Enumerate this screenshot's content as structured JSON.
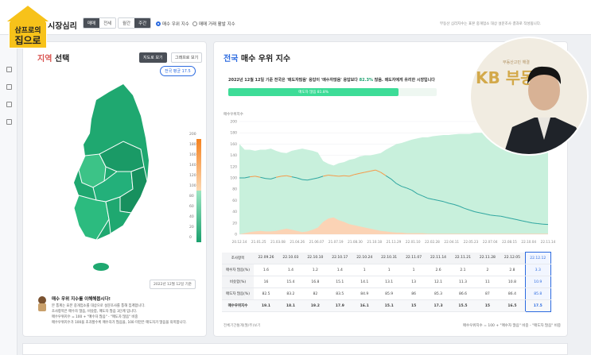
{
  "logo": {
    "line1": "삼프로의",
    "line2": "집으로"
  },
  "header": {
    "title": "시장심리",
    "seg1": [
      "매매",
      "전세"
    ],
    "seg2": [
      "월간",
      "주간"
    ],
    "radio1": "매수 우위 지수",
    "radio2": "매매 거래 활발 지수",
    "note": "부동산 심리지수는 표본 중개업소 대상 설문조사 결과로 작성됩니다."
  },
  "left": {
    "title_hl": "지역",
    "title_rest": " 선택",
    "btn_map": "지도로 보기",
    "btn_graph": "그래프로 보기",
    "pill": "전국 평균 17.5",
    "legend": [
      "200",
      "180",
      "160",
      "140",
      "120",
      "100",
      "80",
      "60",
      "40",
      "20",
      "0"
    ],
    "date": "2022년 12월 12일 기준",
    "info_title": "매수 우위 지수를 이해해봅시다!",
    "info_lines": [
      "본 통계는 표본 중개업소를 대상으로 설문조사를 통해 집계합니다.",
      "조사항목은 매수자 많음, 비슷함, 매도자 많음 3단계 입니다.",
      "매수우위지수 = 100 + \"매수자 많음\" - \"매도자 많음\" 비중",
      "매수우위지수가 100을 초과할수록 매수자가 많음을, 100 미만은 매도자가 많음을 의미합니다."
    ],
    "colors": {
      "map_green": "#1fa870",
      "map_light": "#3cc387",
      "accent": "#f5821f"
    }
  },
  "right": {
    "title_hl": "전국",
    "title_rest": " 매수 우위 지수",
    "summary_pre": "2022년 12월 12일 기준 전국은 '매도자많음' 응답이 '매수자많음' 응답보다 ",
    "summary_pct": "82.3%",
    "summary_post": " 많음. 매도자에게 유리한 시장입니다",
    "bar_label": "매도자 많음 81.8%",
    "bar_fraction": 0.818,
    "series_label": "매수우위지수",
    "footnote_left": "전체기간통계(월/주)보기",
    "footnote_right": "매수우위지수 = 100 + \"매수자 많음\" 비중 - \"매도자 많음\" 비중"
  },
  "chart_data": {
    "type": "area",
    "ylim": [
      0,
      200
    ],
    "yticks": [
      0,
      20,
      40,
      60,
      80,
      100,
      120,
      140,
      160,
      180,
      200
    ],
    "x_labels": [
      "20.12.14",
      "21.01.25",
      "21.03.08",
      "21.04.26",
      "21.06.07",
      "21.07.19",
      "21.08.30",
      "21.10.18",
      "21.11.29",
      "22.01.10",
      "22.02.28",
      "22.04.11",
      "22.05.23",
      "22.07.04",
      "22.08.15",
      "22.10.04",
      "22.11.14"
    ],
    "series": [
      {
        "values": [
          100,
          100,
          102,
          103,
          101,
          99,
          98,
          101,
          103,
          104,
          102,
          100,
          97,
          96,
          98,
          100,
          103,
          105,
          104,
          103,
          104,
          103,
          106,
          108,
          110,
          112,
          114,
          110,
          104,
          98,
          90,
          85,
          82,
          78,
          72,
          68,
          64,
          62,
          60,
          58,
          55,
          53,
          50,
          46,
          43,
          40,
          38,
          36,
          34,
          33,
          32,
          30,
          28,
          26,
          24,
          22,
          20,
          19,
          18,
          17.5
        ]
      },
      {
        "values": [
          0,
          2,
          4,
          5,
          6,
          5,
          5,
          6,
          8,
          10,
          8,
          6,
          4,
          5,
          8,
          12,
          22,
          28,
          30,
          25,
          22,
          18,
          16,
          14,
          12,
          10,
          8,
          6,
          5,
          4,
          3,
          3,
          2,
          2,
          2,
          2,
          1,
          1,
          1,
          1,
          1,
          1,
          1,
          1,
          1,
          1,
          1,
          1,
          1,
          1,
          1,
          1,
          1,
          1,
          1,
          1,
          1,
          1,
          1,
          1
        ]
      },
      {
        "values": [
          160,
          150,
          150,
          148,
          150,
          150,
          152,
          148,
          145,
          144,
          148,
          150,
          152,
          150,
          148,
          145,
          130,
          125,
          122,
          126,
          128,
          132,
          134,
          138,
          140,
          140,
          142,
          144,
          150,
          155,
          160,
          162,
          165,
          168,
          170,
          172,
          172,
          174,
          175,
          176,
          176,
          177,
          178,
          178,
          178,
          180,
          180,
          180,
          182,
          182,
          183,
          184,
          184,
          185,
          186,
          186,
          186,
          186,
          186,
          186
        ]
      }
    ]
  },
  "table": {
    "header": [
      "조사항목",
      "22.09.26",
      "22.10.03",
      "22.10.10",
      "22.10.17",
      "22.10.24",
      "22.10.31",
      "22.11.07",
      "22.11.14",
      "22.11.21",
      "22.11.28",
      "22.12.05",
      "22.12.12"
    ],
    "rows": [
      [
        "매수자 많음(%)",
        "1.6",
        "1.4",
        "1.2",
        "1.4",
        "1",
        "1",
        "1",
        "2.6",
        "2.1",
        "2",
        "2.8",
        "3.3"
      ],
      [
        "비슷함(%)",
        "16",
        "15.4",
        "16.8",
        "15.1",
        "14.1",
        "13.1",
        "13",
        "12.1",
        "11.3",
        "11",
        "10.8",
        "10.9"
      ],
      [
        "매도자 많음(%)",
        "82.5",
        "83.2",
        "82",
        "83.5",
        "84.9",
        "85.9",
        "86",
        "85.3",
        "86.6",
        "87",
        "86.4",
        "85.8"
      ],
      [
        "매수우위지수",
        "19.1",
        "18.1",
        "19.2",
        "17.9",
        "16.1",
        "15.1",
        "15",
        "17.3",
        "15.5",
        "15",
        "16.5",
        "17.5"
      ]
    ]
  },
  "webcam": {
    "brand": "KB 부동",
    "sub": "부동산고민 해결"
  }
}
